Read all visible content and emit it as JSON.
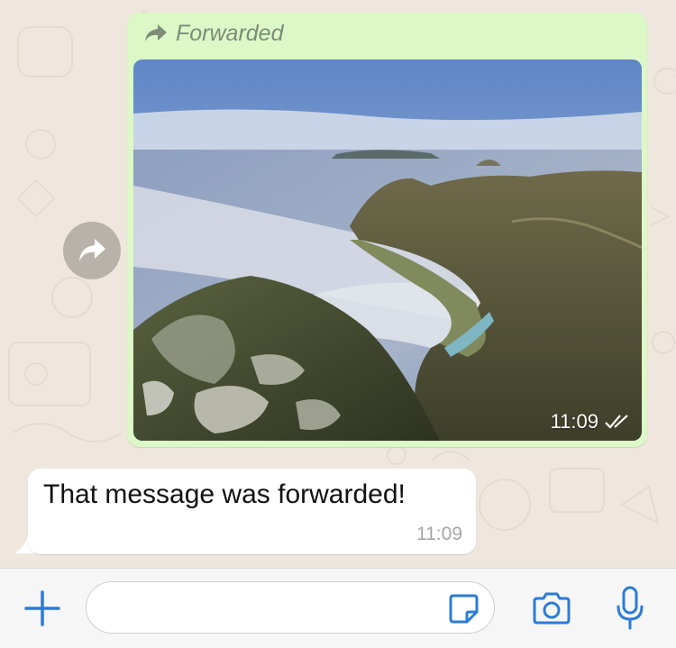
{
  "chat": {
    "outgoing_message": {
      "forwarded_label": "Forwarded",
      "time": "11:09",
      "status": "read-double-check",
      "image": "coastal-mountain-landscape-photo"
    },
    "incoming_message": {
      "text": "That message was forwarded!",
      "time": "11:09"
    }
  },
  "composer": {
    "input_value": "",
    "icons": [
      "plus-icon",
      "sticker-icon",
      "camera-icon",
      "microphone-icon"
    ]
  },
  "colors": {
    "outgoing_bubble": "#dcf8c6",
    "incoming_bubble": "#ffffff",
    "accent_blue": "#2b7cd6",
    "chat_background": "#efe7dd"
  }
}
